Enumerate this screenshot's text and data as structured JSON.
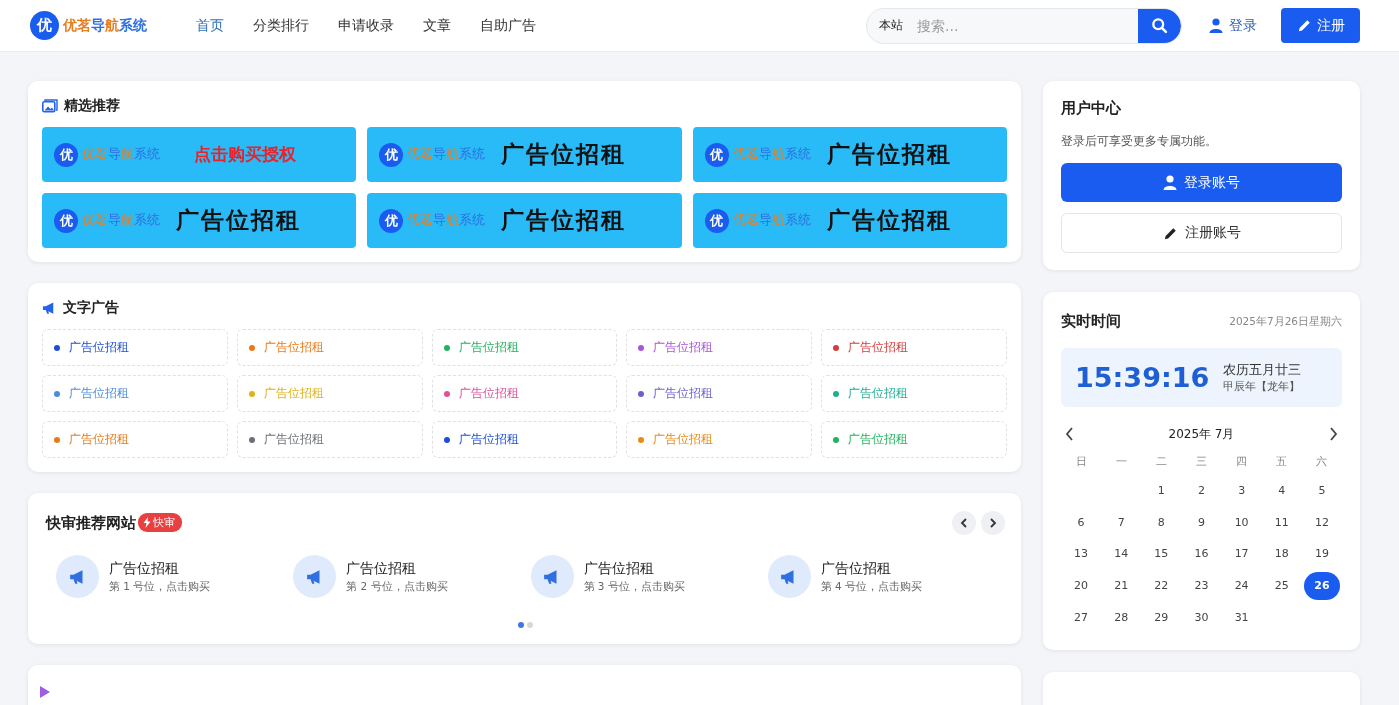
{
  "header": {
    "logo": {
      "badge": "优",
      "name": "优茗导航系统"
    },
    "nav": [
      {
        "label": "首页",
        "selected": true
      },
      {
        "label": "分类排行",
        "selected": false
      },
      {
        "label": "申请收录",
        "selected": false
      },
      {
        "label": "文章",
        "selected": false
      },
      {
        "label": "自助广告",
        "selected": false
      }
    ],
    "search": {
      "scope": "本站",
      "placeholder": "搜索..."
    },
    "login": "登录",
    "register": "注册"
  },
  "featured": {
    "title": "精选推荐",
    "banners": [
      {
        "badge": "优",
        "brand": "优茗导航系统",
        "text": "点击购买授权",
        "kind": "promo"
      },
      {
        "badge": "优",
        "brand": "优茗导航系统",
        "text": "广告位招租",
        "kind": "rent"
      },
      {
        "badge": "优",
        "brand": "优茗导航系统",
        "text": "广告位招租",
        "kind": "rent"
      },
      {
        "badge": "优",
        "brand": "优茗导航系统",
        "text": "广告位招租",
        "kind": "rent"
      },
      {
        "badge": "优",
        "brand": "优茗导航系统",
        "text": "广告位招租",
        "kind": "rent"
      },
      {
        "badge": "优",
        "brand": "优茗导航系统",
        "text": "广告位招租",
        "kind": "rent"
      }
    ]
  },
  "text_ads": {
    "title": "文字广告",
    "items": [
      {
        "label": "广告位招租",
        "color": "#1d4ed8"
      },
      {
        "label": "广告位招租",
        "color": "#ea7a17"
      },
      {
        "label": "广告位招租",
        "color": "#22b35e"
      },
      {
        "label": "广告位招租",
        "color": "#a855d7"
      },
      {
        "label": "广告位招租",
        "color": "#d63c3c"
      },
      {
        "label": "广告位招租",
        "color": "#4a8de0"
      },
      {
        "label": "广告位招租",
        "color": "#e0b21a"
      },
      {
        "label": "广告位招租",
        "color": "#e0509a"
      },
      {
        "label": "广告位招租",
        "color": "#6a5fd0"
      },
      {
        "label": "广告位招租",
        "color": "#1fae92"
      },
      {
        "label": "广告位招租",
        "color": "#ea7a17"
      },
      {
        "label": "广告位招租",
        "color": "#6b6f76"
      },
      {
        "label": "广告位招租",
        "color": "#1d4ed8"
      },
      {
        "label": "广告位招租",
        "color": "#ea8a12"
      },
      {
        "label": "广告位招租",
        "color": "#22b35e"
      }
    ]
  },
  "quick": {
    "title": "快审推荐网站",
    "badge": "快审",
    "items": [
      {
        "title": "广告位招租",
        "subtitle": "第 1 号位，点击购买"
      },
      {
        "title": "广告位招租",
        "subtitle": "第 2 号位，点击购买"
      },
      {
        "title": "广告位招租",
        "subtitle": "第 3 号位，点击购买"
      },
      {
        "title": "广告位招租",
        "subtitle": "第 4 号位，点击购买"
      }
    ],
    "pages": [
      {
        "selected": true
      },
      {
        "selected": false
      }
    ]
  },
  "user_center": {
    "title": "用户中心",
    "note": "登录后可享受更多专属功能。",
    "login_button": "登录账号",
    "register_button": "注册账号"
  },
  "clock": {
    "title": "实时时间",
    "date": "2025年7月26日星期六",
    "time": "15:39:16",
    "lunar": "农历五月廿三",
    "year": "甲辰年【龙年】",
    "month": "2025年 7月",
    "weekdays": [
      "日",
      "一",
      "二",
      "三",
      "四",
      "五",
      "六"
    ],
    "weeks": [
      {
        "kind": "tail",
        "days": [
          {
            "day": "1",
            "selected": false
          },
          {
            "day": "2",
            "selected": false
          },
          {
            "day": "3",
            "selected": false
          },
          {
            "day": "4",
            "selected": false
          },
          {
            "day": "5",
            "selected": false
          }
        ]
      },
      {
        "kind": "full",
        "days": [
          {
            "day": "6",
            "selected": false
          },
          {
            "day": "7",
            "selected": false
          },
          {
            "day": "8",
            "selected": false
          },
          {
            "day": "9",
            "selected": false
          },
          {
            "day": "10",
            "selected": false
          },
          {
            "day": "11",
            "selected": false
          },
          {
            "day": "12",
            "selected": false
          }
        ]
      },
      {
        "kind": "full",
        "days": [
          {
            "day": "13",
            "selected": false
          },
          {
            "day": "14",
            "selected": false
          },
          {
            "day": "15",
            "selected": false
          },
          {
            "day": "16",
            "selected": false
          },
          {
            "day": "17",
            "selected": false
          },
          {
            "day": "18",
            "selected": false
          },
          {
            "day": "19",
            "selected": false
          }
        ]
      },
      {
        "kind": "full",
        "days": [
          {
            "day": "20",
            "selected": false
          },
          {
            "day": "21",
            "selected": false
          },
          {
            "day": "22",
            "selected": false
          },
          {
            "day": "23",
            "selected": false
          },
          {
            "day": "24",
            "selected": false
          },
          {
            "day": "25",
            "selected": false
          },
          {
            "day": "26",
            "selected": true
          }
        ]
      },
      {
        "kind": "head",
        "days": [
          {
            "day": "27",
            "selected": false
          },
          {
            "day": "28",
            "selected": false
          },
          {
            "day": "29",
            "selected": false
          },
          {
            "day": "30",
            "selected": false
          },
          {
            "day": "31",
            "selected": false
          }
        ]
      }
    ]
  }
}
